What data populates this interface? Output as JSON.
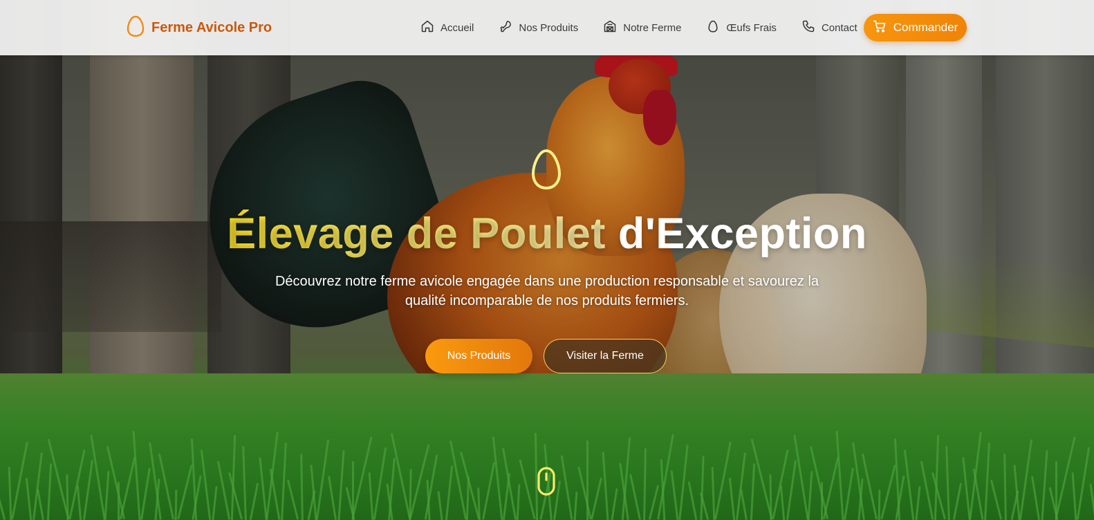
{
  "brand": {
    "name": "Ferme Avicole Pro",
    "icon": "egg-icon",
    "color": "#c9590c"
  },
  "nav": {
    "items": [
      {
        "label": "Accueil",
        "icon": "home-icon"
      },
      {
        "label": "Nos Produits",
        "icon": "drumstick-icon"
      },
      {
        "label": "Notre Ferme",
        "icon": "barn-icon"
      },
      {
        "label": "Œufs Frais",
        "icon": "egg-icon"
      },
      {
        "label": "Contact",
        "icon": "phone-icon"
      }
    ],
    "cta_label": "Commander",
    "cta_icon": "cart-icon"
  },
  "hero": {
    "icon": "egg-icon",
    "title_accent": "Élevage de Poulet",
    "title_rest": "d'Exception",
    "subtitle": "Découvrez notre ferme avicole engagée dans une production responsable et savourez la qualité incomparable de nos produits fermiers.",
    "primary_button": "Nos Produits",
    "secondary_button": "Visiter la Ferme",
    "scroll_icon": "mouse-scroll-icon"
  },
  "colors": {
    "accent_orange": "#f7960e",
    "accent_yellow": "#fde32a",
    "nav_text": "#3b3b3b"
  }
}
